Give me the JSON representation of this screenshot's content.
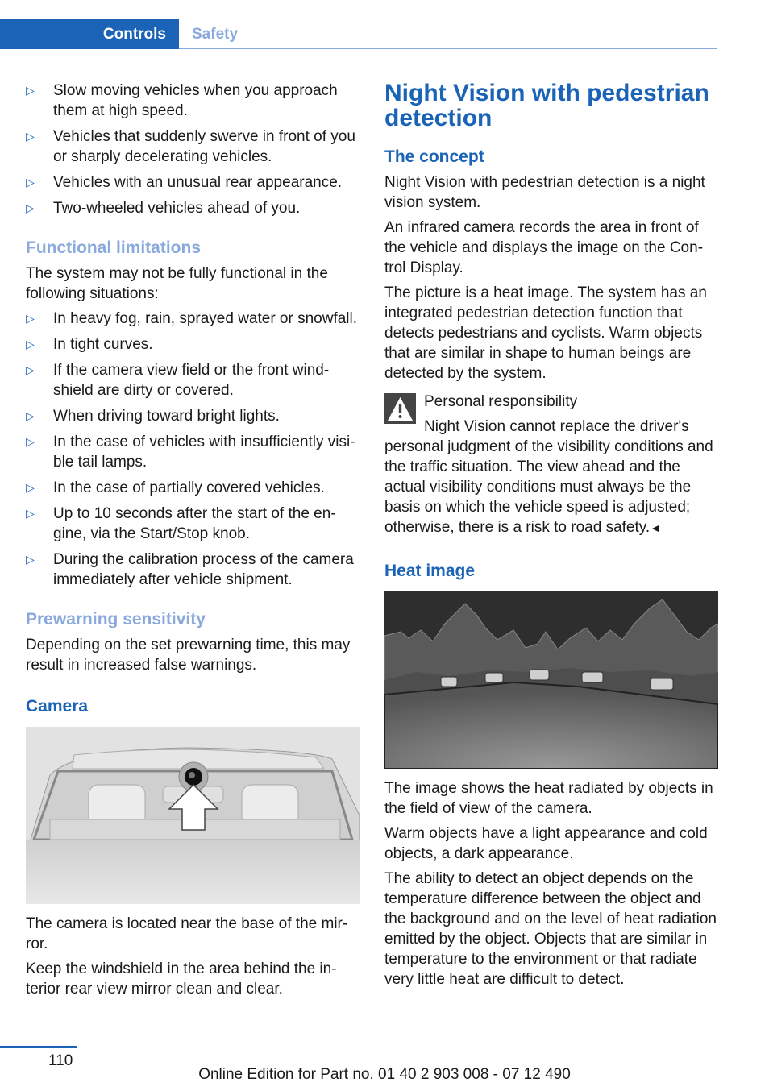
{
  "header": {
    "tabs": [
      {
        "label": "Controls",
        "active": true
      },
      {
        "label": "Safety",
        "active": false
      }
    ]
  },
  "left": {
    "intro_bullets": [
      "Slow moving vehicles when you approach them at high speed.",
      "Vehicles that suddenly swerve in front of you or sharply decelerating vehicles.",
      "Vehicles with an unusual rear appearance.",
      "Two-wheeled vehicles ahead of you."
    ],
    "functional_limitations": {
      "heading": "Functional limitations",
      "intro": "The system may not be fully functional in the following situations:",
      "bullets": [
        "In heavy fog, rain, sprayed water or snowfall.",
        "In tight curves.",
        "If the camera view field or the front wind-shield are dirty or covered.",
        "When driving toward bright lights.",
        "In the case of vehicles with insufficiently visi-ble tail lamps.",
        "In the case of partially covered vehicles.",
        "Up to 10 seconds after the start of the en-gine, via the Start/Stop knob.",
        "During the calibration process of the camera immediately after vehicle shipment."
      ]
    },
    "prewarning": {
      "heading": "Prewarning sensitivity",
      "text": "Depending on the set prewarning time, this may result in increased false warnings."
    },
    "camera": {
      "heading": "Camera",
      "figure_alt": "Car windshield interior with arrow pointing to camera near mirror base",
      "paragraphs": [
        "The camera is located near the base of the mir-ror.",
        "Keep the windshield in the area behind the in-terior rear view mirror clean and clear."
      ]
    }
  },
  "right": {
    "title": "Night Vision with pedestrian detection",
    "concept": {
      "heading": "The concept",
      "paragraphs": [
        "Night Vision with pedestrian detection is a night vision system.",
        "An infrared camera records the area in front of the vehicle and displays the image on the Con-trol Display.",
        "The picture is a heat image. The system has an integrated pedestrian detection function that detects pedestrians and cyclists. Warm objects that are similar in shape to human beings are detected by the system."
      ]
    },
    "warning": {
      "icon": "warning-triangle-icon",
      "title": "Personal responsibility",
      "text": "Night Vision cannot replace the driver's personal judgment of the visibility conditions and the traffic situation. The view ahead and the actual visibility conditions must always be the basis on which the vehicle speed is adjusted; otherwise, there is a risk to road safety.",
      "end_mark": "◄"
    },
    "heat_image": {
      "heading": "Heat image",
      "figure_alt": "Thermal image of forest with five animals crossing a road",
      "paragraphs": [
        "The image shows the heat radiated by objects in the field of view of the camera.",
        "Warm objects have a light appearance and cold objects, a dark appearance.",
        "The ability to detect an object depends on the temperature difference between the object and the background and on the level of heat radiation emitted by the object. Objects that are similar in temperature to the environment or that radiate very little heat are difficult to detect."
      ]
    }
  },
  "footer": {
    "page_number": "110",
    "edition": "Online Edition for Part no. 01 40 2 903 008 - 07 12 490"
  },
  "bullet_marker": "▷"
}
